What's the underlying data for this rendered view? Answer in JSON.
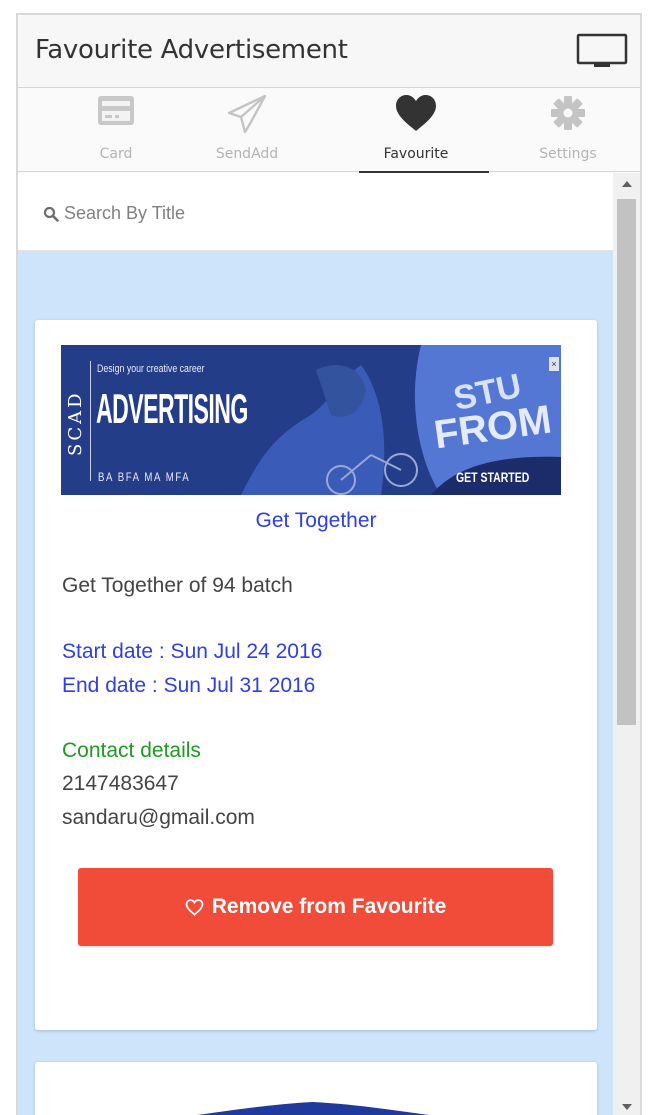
{
  "header": {
    "title": "Favourite Advertisement",
    "monitor_icon": "monitor-icon"
  },
  "tabs": [
    {
      "label": "Card",
      "icon": "credit-card-icon",
      "active": false
    },
    {
      "label": "SendAdd",
      "icon": "paper-plane-icon",
      "active": false
    },
    {
      "label": "Favourite",
      "icon": "heart-icon",
      "active": true
    },
    {
      "label": "Settings",
      "icon": "gear-icon",
      "active": false
    }
  ],
  "search": {
    "placeholder": "Search By Title",
    "value": ""
  },
  "cards": [
    {
      "ad": {
        "brand": "SCAD",
        "tagline": "Design your creative career",
        "headline": "ADVERTISING",
        "degrees": "BA  BFA  MA  MFA",
        "cta": "GET STARTED"
      },
      "title": "Get Together",
      "description": "Get Together of 94 batch",
      "start_date": "Start date : Sun Jul 24 2016",
      "end_date": "End date : Sun Jul 31 2016",
      "contact_heading": "Contact details",
      "phone": "2147483647",
      "email": "sandaru@gmail.com",
      "remove_label": "Remove from Favourite"
    }
  ],
  "colors": {
    "content_background": "#cde4fb",
    "link_blue": "#2f3fe0",
    "contact_green": "#1f9a22",
    "remove_red": "#f14c3a",
    "ad_navy": "#243d88"
  }
}
